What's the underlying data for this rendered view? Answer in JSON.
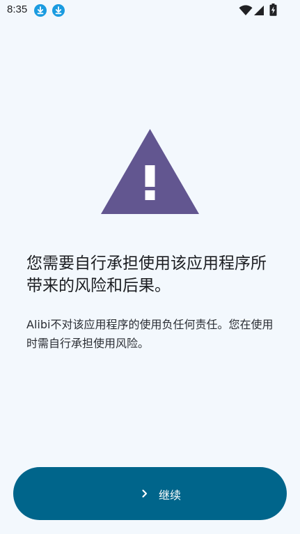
{
  "status_bar": {
    "time": "8:35",
    "icons": [
      "download-icon",
      "download-icon",
      "wifi-icon",
      "signal-icon",
      "battery-charging-icon"
    ]
  },
  "warning": {
    "icon": "warning-triangle-icon",
    "color": "#625690"
  },
  "headline": "您需要自行承担使用该应用程序所带来的风险和后果。",
  "body": "Alibi不对该应用程序的使用负任何责任。您在使用时需自行承担使用风险。",
  "continue_button": {
    "label": "继续",
    "icon": "chevron-right-icon",
    "color": "#00658b"
  }
}
